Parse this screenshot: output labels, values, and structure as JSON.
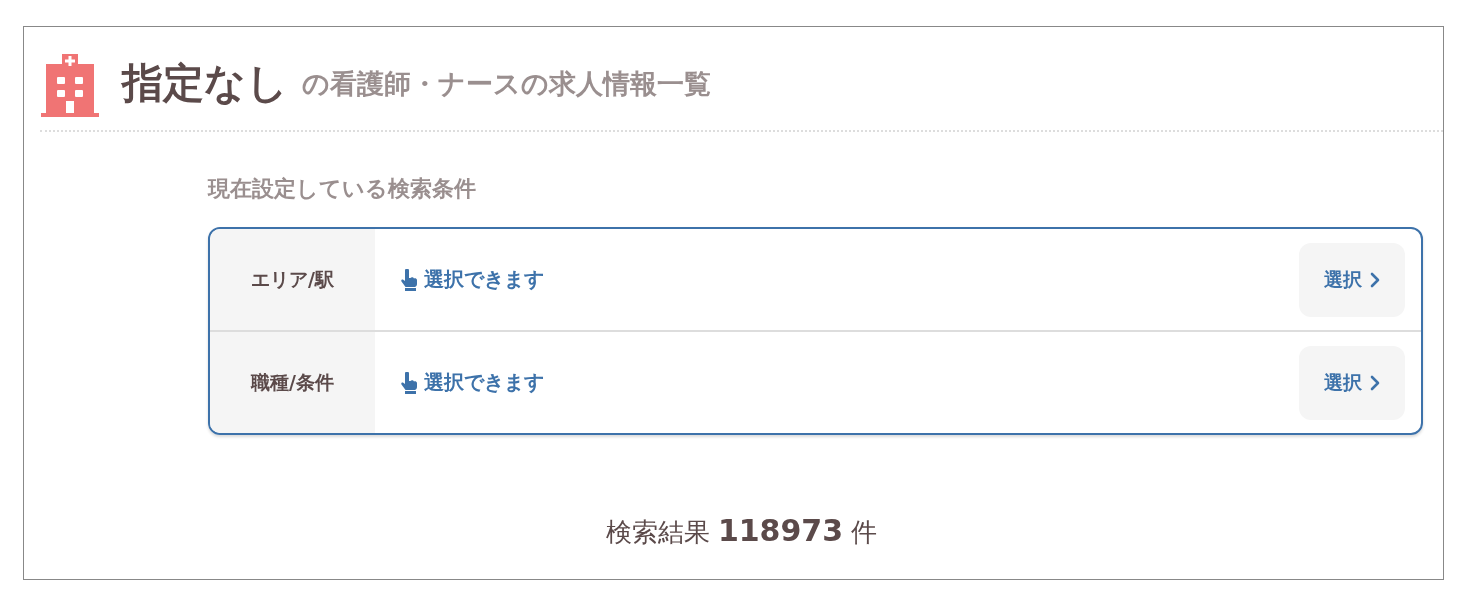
{
  "heading": {
    "title": "指定なし",
    "subtitle": "の看護師・ナースの求人情報一覧"
  },
  "conditions": {
    "title": "現在設定している検索条件",
    "rows": [
      {
        "label": "エリア/駅",
        "value": "選択できます",
        "button": "選択"
      },
      {
        "label": "職種/条件",
        "value": "選択できます",
        "button": "選択"
      }
    ]
  },
  "result": "検索結果 **118973** 件"
}
